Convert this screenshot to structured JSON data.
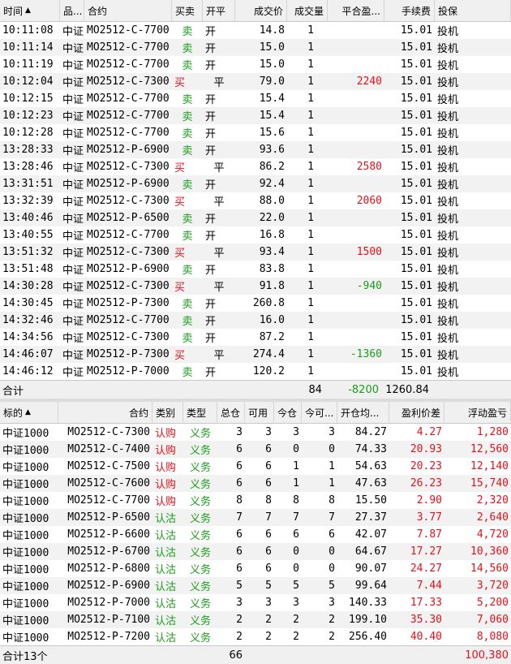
{
  "trades": {
    "headers": [
      "时间",
      "品...",
      "合约",
      "买卖",
      "开平",
      "成交价",
      "成交量",
      "平合盈...",
      "手续费",
      "投保"
    ],
    "sort_icon": "▲",
    "rows": [
      {
        "time": "10:11:08",
        "prod": "中证",
        "contract": "MO2512-C-7700",
        "side": "卖",
        "oc": "开",
        "price": "14.8",
        "vol": "1",
        "pnl": "",
        "fee": "15.01",
        "hedge": "投机"
      },
      {
        "time": "10:11:14",
        "prod": "中证",
        "contract": "MO2512-C-7700",
        "side": "卖",
        "oc": "开",
        "price": "15.0",
        "vol": "1",
        "pnl": "",
        "fee": "15.01",
        "hedge": "投机"
      },
      {
        "time": "10:11:19",
        "prod": "中证",
        "contract": "MO2512-C-7700",
        "side": "卖",
        "oc": "开",
        "price": "15.0",
        "vol": "1",
        "pnl": "",
        "fee": "15.01",
        "hedge": "投机"
      },
      {
        "time": "10:12:04",
        "prod": "中证",
        "contract": "MO2512-C-7300",
        "side": "买",
        "oc": "平",
        "price": "79.0",
        "vol": "1",
        "pnl": "2240",
        "fee": "15.01",
        "hedge": "投机"
      },
      {
        "time": "10:12:15",
        "prod": "中证",
        "contract": "MO2512-C-7700",
        "side": "卖",
        "oc": "开",
        "price": "15.4",
        "vol": "1",
        "pnl": "",
        "fee": "15.01",
        "hedge": "投机"
      },
      {
        "time": "10:12:23",
        "prod": "中证",
        "contract": "MO2512-C-7700",
        "side": "卖",
        "oc": "开",
        "price": "15.4",
        "vol": "1",
        "pnl": "",
        "fee": "15.01",
        "hedge": "投机"
      },
      {
        "time": "10:12:28",
        "prod": "中证",
        "contract": "MO2512-C-7700",
        "side": "卖",
        "oc": "开",
        "price": "15.6",
        "vol": "1",
        "pnl": "",
        "fee": "15.01",
        "hedge": "投机"
      },
      {
        "time": "13:28:33",
        "prod": "中证",
        "contract": "MO2512-P-6900",
        "side": "卖",
        "oc": "开",
        "price": "93.6",
        "vol": "1",
        "pnl": "",
        "fee": "15.01",
        "hedge": "投机"
      },
      {
        "time": "13:28:46",
        "prod": "中证",
        "contract": "MO2512-C-7300",
        "side": "买",
        "oc": "平",
        "price": "86.2",
        "vol": "1",
        "pnl": "2580",
        "fee": "15.01",
        "hedge": "投机"
      },
      {
        "time": "13:31:51",
        "prod": "中证",
        "contract": "MO2512-P-6900",
        "side": "卖",
        "oc": "开",
        "price": "92.4",
        "vol": "1",
        "pnl": "",
        "fee": "15.01",
        "hedge": "投机"
      },
      {
        "time": "13:32:39",
        "prod": "中证",
        "contract": "MO2512-C-7300",
        "side": "买",
        "oc": "平",
        "price": "88.0",
        "vol": "1",
        "pnl": "2060",
        "fee": "15.01",
        "hedge": "投机"
      },
      {
        "time": "13:40:46",
        "prod": "中证",
        "contract": "MO2512-P-6500",
        "side": "卖",
        "oc": "开",
        "price": "22.0",
        "vol": "1",
        "pnl": "",
        "fee": "15.01",
        "hedge": "投机"
      },
      {
        "time": "13:40:55",
        "prod": "中证",
        "contract": "MO2512-C-7700",
        "side": "卖",
        "oc": "开",
        "price": "16.8",
        "vol": "1",
        "pnl": "",
        "fee": "15.01",
        "hedge": "投机"
      },
      {
        "time": "13:51:32",
        "prod": "中证",
        "contract": "MO2512-C-7300",
        "side": "买",
        "oc": "平",
        "price": "93.4",
        "vol": "1",
        "pnl": "1500",
        "fee": "15.01",
        "hedge": "投机"
      },
      {
        "time": "13:51:48",
        "prod": "中证",
        "contract": "MO2512-P-6900",
        "side": "卖",
        "oc": "开",
        "price": "83.8",
        "vol": "1",
        "pnl": "",
        "fee": "15.01",
        "hedge": "投机"
      },
      {
        "time": "14:30:28",
        "prod": "中证",
        "contract": "MO2512-C-7300",
        "side": "买",
        "oc": "平",
        "price": "91.8",
        "vol": "1",
        "pnl": "-940",
        "fee": "15.01",
        "hedge": "投机"
      },
      {
        "time": "14:30:45",
        "prod": "中证",
        "contract": "MO2512-P-7300",
        "side": "卖",
        "oc": "开",
        "price": "260.8",
        "vol": "1",
        "pnl": "",
        "fee": "15.01",
        "hedge": "投机"
      },
      {
        "time": "14:32:46",
        "prod": "中证",
        "contract": "MO2512-C-7700",
        "side": "卖",
        "oc": "开",
        "price": "16.0",
        "vol": "1",
        "pnl": "",
        "fee": "15.01",
        "hedge": "投机"
      },
      {
        "time": "14:34:56",
        "prod": "中证",
        "contract": "MO2512-C-7300",
        "side": "卖",
        "oc": "开",
        "price": "87.2",
        "vol": "1",
        "pnl": "",
        "fee": "15.01",
        "hedge": "投机"
      },
      {
        "time": "14:46:07",
        "prod": "中证",
        "contract": "MO2512-P-7300",
        "side": "买",
        "oc": "平",
        "price": "274.4",
        "vol": "1",
        "pnl": "-1360",
        "fee": "15.01",
        "hedge": "投机"
      },
      {
        "time": "14:46:12",
        "prod": "中证",
        "contract": "MO2512-P-7000",
        "side": "卖",
        "oc": "开",
        "price": "120.2",
        "vol": "1",
        "pnl": "",
        "fee": "15.01",
        "hedge": "投机"
      }
    ],
    "total": {
      "label": "合计",
      "vol": "84",
      "pnl": "-8200",
      "fee": "1260.84"
    }
  },
  "positions": {
    "headers": [
      "标的",
      "合约",
      "类别",
      "类型",
      "总仓",
      "可用",
      "今仓",
      "今可...",
      "开仓均...",
      "盈利价差",
      "浮动盈亏"
    ],
    "sort_icon": "▲",
    "rows": [
      {
        "underlying": "中证1000",
        "contract": "MO2512-C-7300",
        "cat": "认购",
        "type": "义务",
        "total": "3",
        "avail": "3",
        "today": "3",
        "today_avail": "3",
        "avg": "84.27",
        "spread": "4.27",
        "float": "1,280"
      },
      {
        "underlying": "中证1000",
        "contract": "MO2512-C-7400",
        "cat": "认购",
        "type": "义务",
        "total": "6",
        "avail": "6",
        "today": "0",
        "today_avail": "0",
        "avg": "74.33",
        "spread": "20.93",
        "float": "12,560"
      },
      {
        "underlying": "中证1000",
        "contract": "MO2512-C-7500",
        "cat": "认购",
        "type": "义务",
        "total": "6",
        "avail": "6",
        "today": "1",
        "today_avail": "1",
        "avg": "54.63",
        "spread": "20.23",
        "float": "12,140"
      },
      {
        "underlying": "中证1000",
        "contract": "MO2512-C-7600",
        "cat": "认购",
        "type": "义务",
        "total": "6",
        "avail": "6",
        "today": "1",
        "today_avail": "1",
        "avg": "47.63",
        "spread": "26.23",
        "float": "15,740"
      },
      {
        "underlying": "中证1000",
        "contract": "MO2512-C-7700",
        "cat": "认购",
        "type": "义务",
        "total": "8",
        "avail": "8",
        "today": "8",
        "today_avail": "8",
        "avg": "15.50",
        "spread": "2.90",
        "float": "2,320"
      },
      {
        "underlying": "中证1000",
        "contract": "MO2512-P-6500",
        "cat": "认沽",
        "type": "义务",
        "total": "7",
        "avail": "7",
        "today": "7",
        "today_avail": "7",
        "avg": "27.37",
        "spread": "3.77",
        "float": "2,640"
      },
      {
        "underlying": "中证1000",
        "contract": "MO2512-P-6600",
        "cat": "认沽",
        "type": "义务",
        "total": "6",
        "avail": "6",
        "today": "6",
        "today_avail": "6",
        "avg": "42.07",
        "spread": "7.87",
        "float": "4,720"
      },
      {
        "underlying": "中证1000",
        "contract": "MO2512-P-6700",
        "cat": "认沽",
        "type": "义务",
        "total": "6",
        "avail": "6",
        "today": "0",
        "today_avail": "0",
        "avg": "64.67",
        "spread": "17.27",
        "float": "10,360"
      },
      {
        "underlying": "中证1000",
        "contract": "MO2512-P-6800",
        "cat": "认沽",
        "type": "义务",
        "total": "6",
        "avail": "6",
        "today": "0",
        "today_avail": "0",
        "avg": "90.07",
        "spread": "24.27",
        "float": "14,560"
      },
      {
        "underlying": "中证1000",
        "contract": "MO2512-P-6900",
        "cat": "认沽",
        "type": "义务",
        "total": "5",
        "avail": "5",
        "today": "5",
        "today_avail": "5",
        "avg": "99.64",
        "spread": "7.44",
        "float": "3,720"
      },
      {
        "underlying": "中证1000",
        "contract": "MO2512-P-7000",
        "cat": "认沽",
        "type": "义务",
        "total": "3",
        "avail": "3",
        "today": "3",
        "today_avail": "3",
        "avg": "140.33",
        "spread": "17.33",
        "float": "5,200"
      },
      {
        "underlying": "中证1000",
        "contract": "MO2512-P-7100",
        "cat": "认沽",
        "type": "义务",
        "total": "2",
        "avail": "2",
        "today": "2",
        "today_avail": "2",
        "avg": "199.10",
        "spread": "35.30",
        "float": "7,060"
      },
      {
        "underlying": "中证1000",
        "contract": "MO2512-P-7200",
        "cat": "认沽",
        "type": "义务",
        "total": "2",
        "avail": "2",
        "today": "2",
        "today_avail": "2",
        "avg": "256.40",
        "spread": "40.40",
        "float": "8,080"
      }
    ],
    "total": {
      "label": "合计13个",
      "total": "66",
      "float": "100,380"
    }
  },
  "colors": {
    "buy": "#e8101a",
    "sell": "#1a9e1a",
    "loss": "#1a9e1a",
    "profit": "#e8101a"
  }
}
